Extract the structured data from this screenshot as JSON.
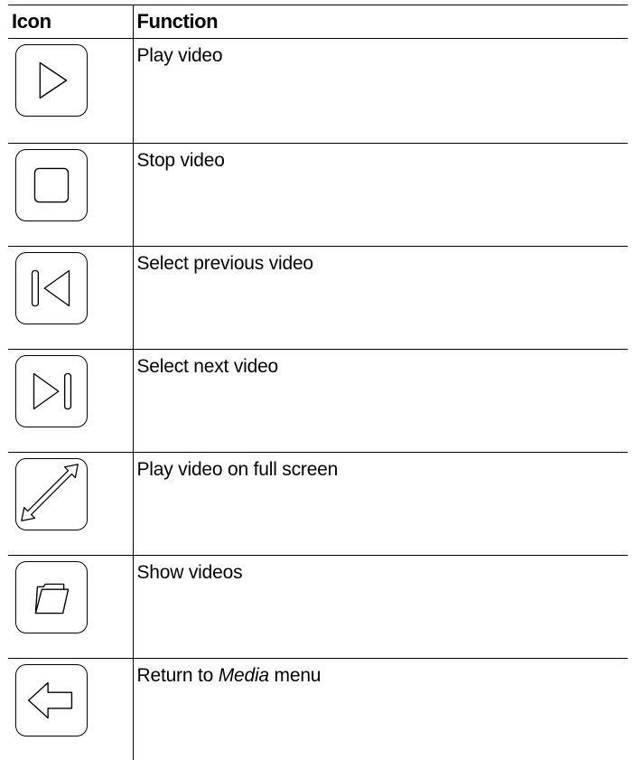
{
  "table": {
    "header": {
      "icon": "Icon",
      "function": "Function"
    },
    "rows": [
      {
        "icon": "play-icon",
        "function": "Play video"
      },
      {
        "icon": "stop-icon",
        "function": "Stop video"
      },
      {
        "icon": "previous-icon",
        "function": "Select previous video"
      },
      {
        "icon": "next-icon",
        "function": "Select next video"
      },
      {
        "icon": "fullscreen-icon",
        "function": "Play video on full screen"
      },
      {
        "icon": "folder-icon",
        "function": "Show videos"
      },
      {
        "icon": "back-arrow-icon",
        "function_prefix": "Return to ",
        "function_emphasis": "Media",
        "function_suffix": " menu"
      }
    ]
  }
}
